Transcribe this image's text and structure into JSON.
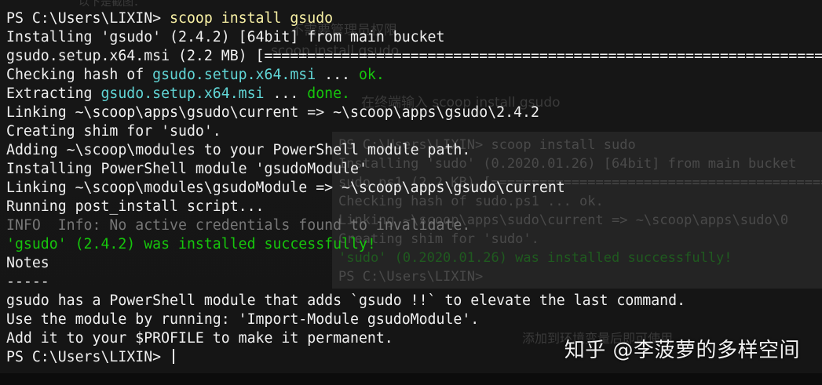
{
  "background_doc": {
    "bullet_text": "以下是截图：",
    "admin_note": "不需要管理员权限",
    "doc_cmd1": "scoop install gsudo",
    "doc_cmd2": "在终端输入 scoop install gsudo",
    "doc_note": "添加到环境变量后即可使用"
  },
  "ghost_terminal": {
    "lines": [
      "PS C:\\Users\\LIXIN> scoop install sudo",
      "Installing 'sudo' (0.2020.01.26) [64bit] from main bucket",
      "sudo.ps1 (2.2 KB) [==========================================",
      "Checking hash of sudo.ps1 ... ok.",
      "Linking ~\\scoop\\apps\\sudo\\current => ~\\scoop\\apps\\sudo\\0",
      "Creating shim for 'sudo'.",
      "'sudo' (0.2020.01.26) was installed successfully!",
      "PS C:\\Users\\LIXIN> "
    ]
  },
  "terminal": {
    "prompt": "PS C:\\Users\\LIXIN> ",
    "command": "scoop install gsudo",
    "l2": "Installing 'gsudo' (2.4.2) [64bit] from main bucket",
    "l3": "gsudo.setup.x64.msi (2.2 MB) [====================================================================",
    "l4_pre": "Checking hash of ",
    "l4_file": "gsudo.setup.x64.msi",
    "l4_dots": " ... ",
    "l4_ok": "ok.",
    "l5_pre": "Extracting ",
    "l5_file": "gsudo.setup.x64.msi",
    "l5_dots": " ... ",
    "l5_done": "done.",
    "l6": "Linking ~\\scoop\\apps\\gsudo\\current => ~\\scoop\\apps\\gsudo\\2.4.2",
    "l7": "Creating shim for 'sudo'.",
    "l8": "Adding ~\\scoop\\modules to your PowerShell module path.",
    "l9": "Installing PowerShell module 'gsudoModule'",
    "l10": "Linking ~\\scoop\\modules\\gsudoModule => ~\\scoop\\apps\\gsudo\\current",
    "l11": "Running post_install script...",
    "l12": "INFO  Info: No active credentials found to invalidate.",
    "l13": "'gsudo' (2.4.2) was installed successfully!",
    "l14": "Notes",
    "l15": "-----",
    "l16": "gsudo has a PowerShell module that adds `gsudo !!` to elevate the last command.",
    "l17": "Use the module by running: 'Import-Module gsudoModule'.",
    "l18": "Add it to your $PROFILE to make it permanent.",
    "final_prompt": "PS C:\\Users\\LIXIN> "
  },
  "watermark": "知乎 @李菠萝的多样空间",
  "colors": {
    "background": "#0c0c0c",
    "text": "#f0f0f0",
    "command": "#f9f1a5",
    "filename": "#61d6d6",
    "success": "#16c60c",
    "info": "#767676"
  }
}
